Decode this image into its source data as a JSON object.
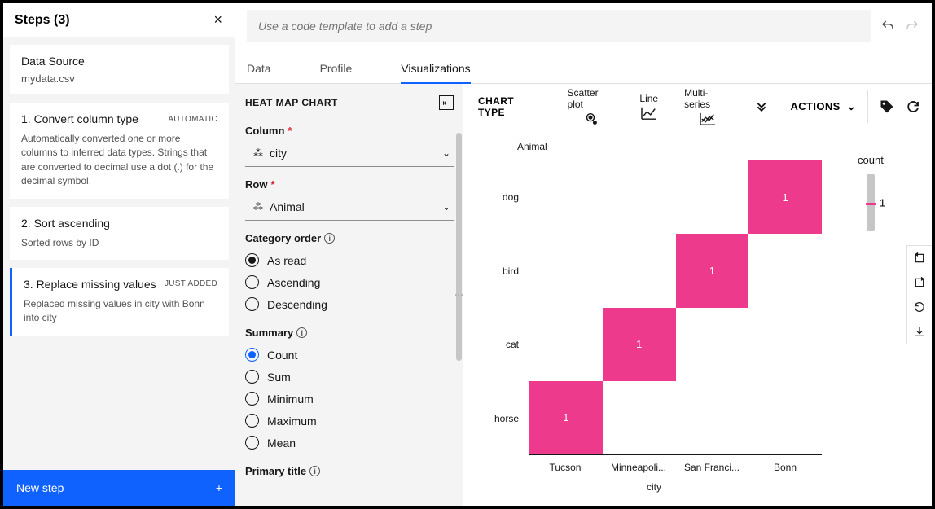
{
  "steps_panel": {
    "title": "Steps (3)",
    "data_source_label": "Data Source",
    "data_source_value": "mydata.csv",
    "steps": [
      {
        "name": "1. Convert column type",
        "tag": "AUTOMATIC",
        "desc": "Automatically converted one or more columns to inferred data types. Strings that are converted to decimal use a dot (.) for the decimal symbol."
      },
      {
        "name": "2. Sort ascending",
        "tag": "",
        "desc": "Sorted rows by ID"
      },
      {
        "name": "3. Replace missing values",
        "tag": "JUST ADDED",
        "desc": "Replaced missing values in city with Bonn into city"
      }
    ],
    "new_step_label": "New step"
  },
  "top": {
    "placeholder": "Use a code template to add a step",
    "tabs": [
      "Data",
      "Profile",
      "Visualizations"
    ],
    "active_tab": 2
  },
  "config": {
    "title": "HEAT MAP CHART",
    "column_label": "Column",
    "column_value": "city",
    "row_label": "Row",
    "row_value": "Animal",
    "category_order_label": "Category order",
    "category_order_options": [
      "As read",
      "Ascending",
      "Descending"
    ],
    "category_order_selected": 0,
    "summary_label": "Summary",
    "summary_options": [
      "Count",
      "Sum",
      "Minimum",
      "Maximum",
      "Mean"
    ],
    "summary_selected": 0,
    "primary_title_label": "Primary title"
  },
  "chart_toolbar": {
    "chart_type_label": "CHART TYPE",
    "options": [
      "Scatter plot",
      "Line",
      "Multi-series"
    ],
    "actions_label": "ACTIONS"
  },
  "chart_data": {
    "type": "heatmap",
    "title": "",
    "xlabel": "city",
    "ylabel": "Animal",
    "x_categories": [
      "Tucson",
      "Minneapoli...",
      "San Franci...",
      "Bonn"
    ],
    "y_categories": [
      "dog",
      "bird",
      "cat",
      "horse"
    ],
    "cells": [
      {
        "x": 3,
        "y": 0,
        "value": 1
      },
      {
        "x": 2,
        "y": 1,
        "value": 1
      },
      {
        "x": 1,
        "y": 2,
        "value": 1
      },
      {
        "x": 0,
        "y": 3,
        "value": 1
      }
    ],
    "legend": {
      "title": "count",
      "value": 1
    }
  }
}
